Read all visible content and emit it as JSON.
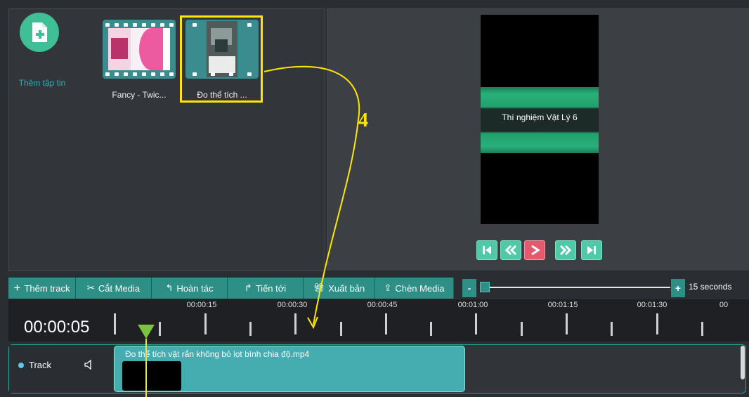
{
  "media_library": {
    "add_file_label": "Thêm tập tin",
    "items": [
      {
        "label": "Fancy - Twic...",
        "thumbnail": "pink-poster-thumbnail"
      },
      {
        "label": "Đo thể tích ...",
        "thumbnail": "lab-video-thumbnail"
      }
    ]
  },
  "preview": {
    "overlay_text": "Thí nghiệm Vật Lý 6",
    "controls": [
      "skip-to-start-icon",
      "rewind-icon",
      "play-icon",
      "fast-forward-icon",
      "skip-to-end-icon"
    ]
  },
  "toolbar": {
    "add_track": "Thêm track",
    "cut_media": "Cắt Media",
    "undo": "Hoàn tác",
    "redo": "Tiến tới",
    "export": "Xuất bản",
    "insert_media": "Chèn Media",
    "zoom_out": "-",
    "zoom_in": "+",
    "zoom_label": "15 seconds"
  },
  "timeline": {
    "current_time": "00:00:05",
    "ruler_labels": [
      "00:00:15",
      "00:00:30",
      "00:00:45",
      "00:01:00",
      "00:01:15",
      "00:01:30",
      "00"
    ],
    "track": {
      "name": "Track",
      "clip_title": "Đo thể tích vật rắn không bỏ lọt bình chia độ.mp4"
    }
  },
  "annotation": {
    "step_number": "4"
  },
  "colors": {
    "accent": "#2d8f86",
    "highlight": "#ffe600",
    "play_button": "#e5596f",
    "clip": "#45acb0"
  }
}
